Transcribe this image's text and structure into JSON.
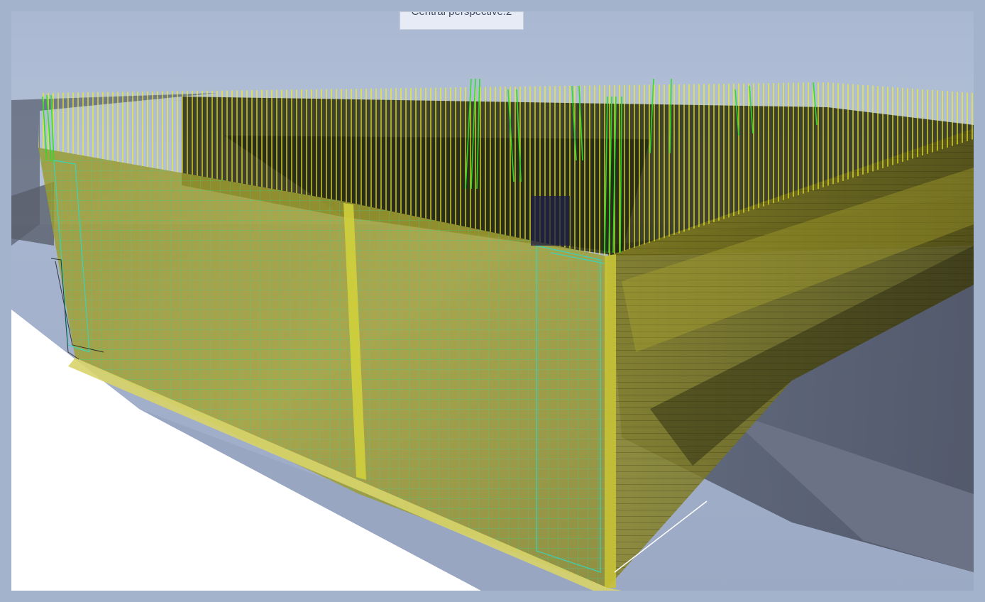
{
  "viewport": {
    "view_name": "Central perspective.2",
    "model_description_hidden": true
  },
  "colors": {
    "background": "#a3b3cc",
    "sky": "#a9b8d3",
    "ground_white": "#ffffff",
    "wall_yellow": "#c9c33a",
    "wall_dark": "#3d3d12",
    "rebar_yellow": "#f2f21a",
    "rebar_green": "#2be32b",
    "rebar_cyan": "#35d9c0",
    "shadow_gray": "#4e5566",
    "tab_background": "#e6ebf5"
  }
}
